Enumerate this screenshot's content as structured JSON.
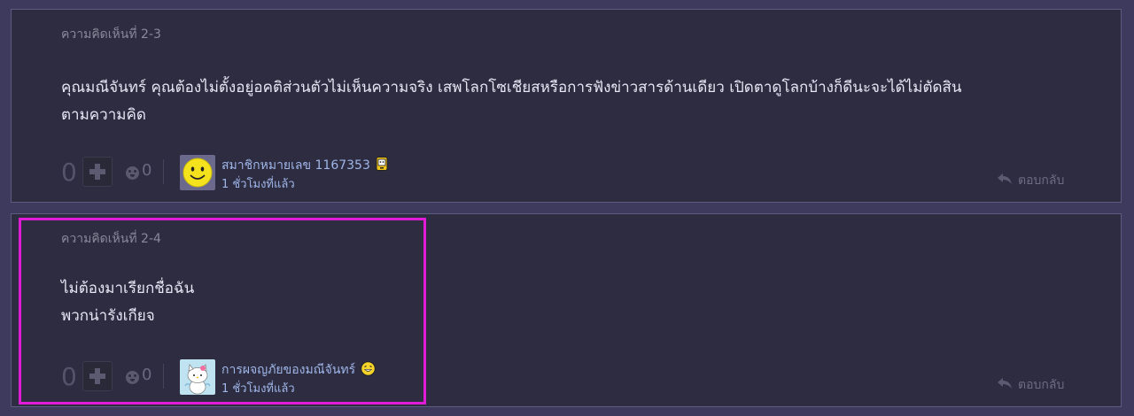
{
  "comments": [
    {
      "label": "ความคิดเห็นที่ 2-3",
      "body": "คุณมณีจันทร์  คุณต้องไม่ตั้งอยู่อคติส่วนตัวไม่เห็นความจริง เสพโลกโซเชียสหรือการฟังข่าวสารด้านเดียว เปิดตาดูโลกบ้างก็ดีนะจะได้ไม่ตัดสิน\nตามความคิด",
      "vote_count": "0",
      "emotion_count": "0",
      "user_name": "สมาชิกหมายเลข 1167353",
      "user_badge_icon": "mobile-phone-badge-icon",
      "time": "1 ชั่วโมงที่แล้ว",
      "reply_label": "ตอบกลับ",
      "avatar_icon": "smiley-face-avatar"
    },
    {
      "label": "ความคิดเห็นที่ 2-4",
      "body": "ไม่ต้องมาเรียกชื่อฉัน\nพวกน่ารังเกียจ",
      "vote_count": "0",
      "emotion_count": "0",
      "user_name": "การผจญภัยของมณีจันทร์",
      "user_badge_icon": "laughing-emoji-badge-icon",
      "time": "1 ชั่วโมงที่แล้ว",
      "reply_label": "ตอบกลับ",
      "avatar_icon": "hello-kitty-avatar"
    }
  ],
  "colors": {
    "background": "#3d3a5e",
    "card": "#2d2c41",
    "username": "#9fb6e8",
    "highlight": "#e21bd8"
  }
}
